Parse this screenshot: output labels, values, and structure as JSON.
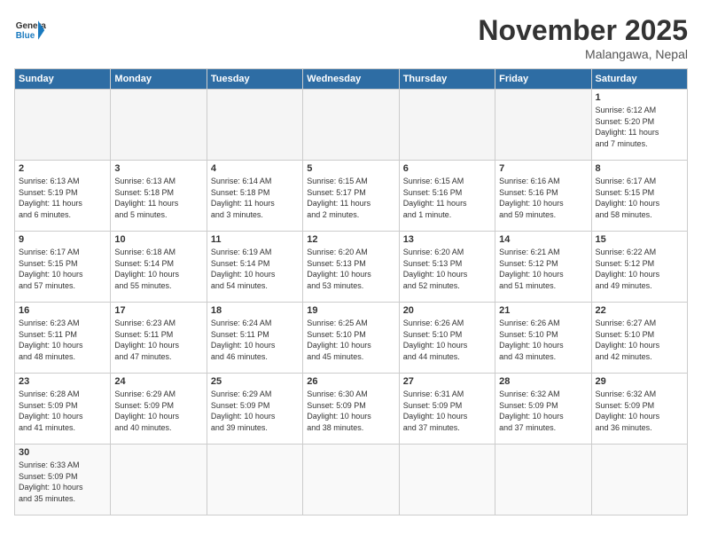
{
  "header": {
    "logo_general": "General",
    "logo_blue": "Blue",
    "month_title": "November 2025",
    "location": "Malangawa, Nepal"
  },
  "days_of_week": [
    "Sunday",
    "Monday",
    "Tuesday",
    "Wednesday",
    "Thursday",
    "Friday",
    "Saturday"
  ],
  "weeks": [
    [
      {
        "day": "",
        "info": ""
      },
      {
        "day": "",
        "info": ""
      },
      {
        "day": "",
        "info": ""
      },
      {
        "day": "",
        "info": ""
      },
      {
        "day": "",
        "info": ""
      },
      {
        "day": "",
        "info": ""
      },
      {
        "day": "1",
        "info": "Sunrise: 6:12 AM\nSunset: 5:20 PM\nDaylight: 11 hours\nand 7 minutes."
      }
    ],
    [
      {
        "day": "2",
        "info": "Sunrise: 6:13 AM\nSunset: 5:19 PM\nDaylight: 11 hours\nand 6 minutes."
      },
      {
        "day": "3",
        "info": "Sunrise: 6:13 AM\nSunset: 5:18 PM\nDaylight: 11 hours\nand 5 minutes."
      },
      {
        "day": "4",
        "info": "Sunrise: 6:14 AM\nSunset: 5:18 PM\nDaylight: 11 hours\nand 3 minutes."
      },
      {
        "day": "5",
        "info": "Sunrise: 6:15 AM\nSunset: 5:17 PM\nDaylight: 11 hours\nand 2 minutes."
      },
      {
        "day": "6",
        "info": "Sunrise: 6:15 AM\nSunset: 5:16 PM\nDaylight: 11 hours\nand 1 minute."
      },
      {
        "day": "7",
        "info": "Sunrise: 6:16 AM\nSunset: 5:16 PM\nDaylight: 10 hours\nand 59 minutes."
      },
      {
        "day": "8",
        "info": "Sunrise: 6:17 AM\nSunset: 5:15 PM\nDaylight: 10 hours\nand 58 minutes."
      }
    ],
    [
      {
        "day": "9",
        "info": "Sunrise: 6:17 AM\nSunset: 5:15 PM\nDaylight: 10 hours\nand 57 minutes."
      },
      {
        "day": "10",
        "info": "Sunrise: 6:18 AM\nSunset: 5:14 PM\nDaylight: 10 hours\nand 55 minutes."
      },
      {
        "day": "11",
        "info": "Sunrise: 6:19 AM\nSunset: 5:14 PM\nDaylight: 10 hours\nand 54 minutes."
      },
      {
        "day": "12",
        "info": "Sunrise: 6:20 AM\nSunset: 5:13 PM\nDaylight: 10 hours\nand 53 minutes."
      },
      {
        "day": "13",
        "info": "Sunrise: 6:20 AM\nSunset: 5:13 PM\nDaylight: 10 hours\nand 52 minutes."
      },
      {
        "day": "14",
        "info": "Sunrise: 6:21 AM\nSunset: 5:12 PM\nDaylight: 10 hours\nand 51 minutes."
      },
      {
        "day": "15",
        "info": "Sunrise: 6:22 AM\nSunset: 5:12 PM\nDaylight: 10 hours\nand 49 minutes."
      }
    ],
    [
      {
        "day": "16",
        "info": "Sunrise: 6:23 AM\nSunset: 5:11 PM\nDaylight: 10 hours\nand 48 minutes."
      },
      {
        "day": "17",
        "info": "Sunrise: 6:23 AM\nSunset: 5:11 PM\nDaylight: 10 hours\nand 47 minutes."
      },
      {
        "day": "18",
        "info": "Sunrise: 6:24 AM\nSunset: 5:11 PM\nDaylight: 10 hours\nand 46 minutes."
      },
      {
        "day": "19",
        "info": "Sunrise: 6:25 AM\nSunset: 5:10 PM\nDaylight: 10 hours\nand 45 minutes."
      },
      {
        "day": "20",
        "info": "Sunrise: 6:26 AM\nSunset: 5:10 PM\nDaylight: 10 hours\nand 44 minutes."
      },
      {
        "day": "21",
        "info": "Sunrise: 6:26 AM\nSunset: 5:10 PM\nDaylight: 10 hours\nand 43 minutes."
      },
      {
        "day": "22",
        "info": "Sunrise: 6:27 AM\nSunset: 5:10 PM\nDaylight: 10 hours\nand 42 minutes."
      }
    ],
    [
      {
        "day": "23",
        "info": "Sunrise: 6:28 AM\nSunset: 5:09 PM\nDaylight: 10 hours\nand 41 minutes."
      },
      {
        "day": "24",
        "info": "Sunrise: 6:29 AM\nSunset: 5:09 PM\nDaylight: 10 hours\nand 40 minutes."
      },
      {
        "day": "25",
        "info": "Sunrise: 6:29 AM\nSunset: 5:09 PM\nDaylight: 10 hours\nand 39 minutes."
      },
      {
        "day": "26",
        "info": "Sunrise: 6:30 AM\nSunset: 5:09 PM\nDaylight: 10 hours\nand 38 minutes."
      },
      {
        "day": "27",
        "info": "Sunrise: 6:31 AM\nSunset: 5:09 PM\nDaylight: 10 hours\nand 37 minutes."
      },
      {
        "day": "28",
        "info": "Sunrise: 6:32 AM\nSunset: 5:09 PM\nDaylight: 10 hours\nand 37 minutes."
      },
      {
        "day": "29",
        "info": "Sunrise: 6:32 AM\nSunset: 5:09 PM\nDaylight: 10 hours\nand 36 minutes."
      }
    ],
    [
      {
        "day": "30",
        "info": "Sunrise: 6:33 AM\nSunset: 5:09 PM\nDaylight: 10 hours\nand 35 minutes."
      },
      {
        "day": "",
        "info": ""
      },
      {
        "day": "",
        "info": ""
      },
      {
        "day": "",
        "info": ""
      },
      {
        "day": "",
        "info": ""
      },
      {
        "day": "",
        "info": ""
      },
      {
        "day": "",
        "info": ""
      }
    ]
  ]
}
